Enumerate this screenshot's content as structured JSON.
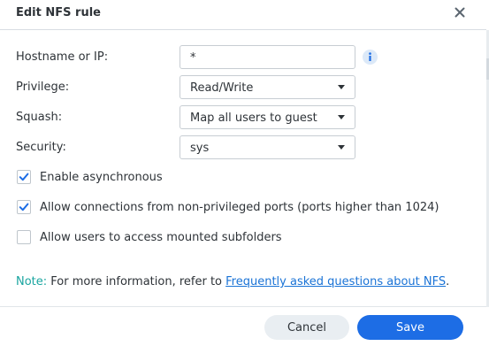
{
  "dialog": {
    "title": "Edit NFS rule",
    "close_icon": "close-icon"
  },
  "form": {
    "hostname": {
      "label": "Hostname or IP:",
      "value": "*",
      "info_icon": "info-icon"
    },
    "privilege": {
      "label": "Privilege:",
      "value": "Read/Write"
    },
    "squash": {
      "label": "Squash:",
      "value": "Map all users to guest"
    },
    "security": {
      "label": "Security:",
      "value": "sys"
    }
  },
  "options": [
    {
      "label": "Enable asynchronous",
      "checked": true
    },
    {
      "label": "Allow connections from non-privileged ports (ports higher than 1024)",
      "checked": true
    },
    {
      "label": "Allow users to access mounted subfolders",
      "checked": false
    }
  ],
  "note": {
    "prefix": "Note:",
    "text": " For more information, refer to ",
    "link": "Frequently asked questions about NFS",
    "suffix": "."
  },
  "buttons": {
    "cancel": "Cancel",
    "save": "Save"
  },
  "colors": {
    "accent": "#1d6de5",
    "note_prefix": "#1aa5a0",
    "link": "#1a73d6",
    "checkmark": "#1d6de5"
  }
}
